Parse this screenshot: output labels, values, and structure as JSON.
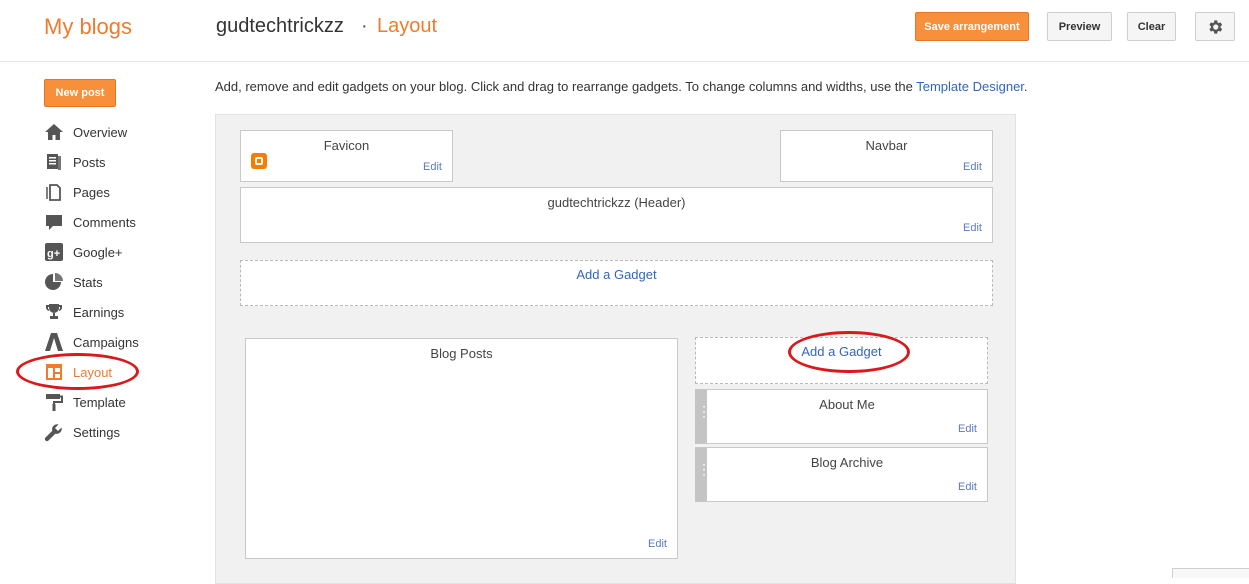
{
  "header": {
    "brand": "My blogs",
    "blog_name": "gudtechtrickzz",
    "separator": "·",
    "page": "Layout",
    "buttons": {
      "save": "Save arrangement",
      "preview": "Preview",
      "clear": "Clear"
    }
  },
  "sidebar": {
    "new_post": "New post",
    "items": [
      {
        "label": "Overview",
        "icon": "home-icon"
      },
      {
        "label": "Posts",
        "icon": "posts-icon"
      },
      {
        "label": "Pages",
        "icon": "pages-icon"
      },
      {
        "label": "Comments",
        "icon": "comment-icon"
      },
      {
        "label": "Google+",
        "icon": "google-plus-icon"
      },
      {
        "label": "Stats",
        "icon": "pie-chart-icon"
      },
      {
        "label": "Earnings",
        "icon": "trophy-icon"
      },
      {
        "label": "Campaigns",
        "icon": "adwords-icon"
      },
      {
        "label": "Layout",
        "icon": "layout-icon",
        "active": true
      },
      {
        "label": "Template",
        "icon": "paint-roller-icon"
      },
      {
        "label": "Settings",
        "icon": "wrench-icon"
      }
    ]
  },
  "main": {
    "intro_text": "Add, remove and edit gadgets on your blog. Click and drag to rearrange gadgets. To change columns and widths, use the ",
    "intro_link": "Template Designer",
    "intro_end": ".",
    "edit_label": "Edit",
    "add_gadget_label": "Add a Gadget",
    "gadgets": {
      "favicon": "Favicon",
      "navbar": "Navbar",
      "header": "gudtechtrickzz (Header)",
      "blog_posts": "Blog Posts",
      "about_me": "About Me",
      "blog_archive": "Blog Archive"
    }
  },
  "colors": {
    "accent": "#f07b2c",
    "button_orange": "#f88f3b",
    "link": "#3366bb",
    "annotation_red": "#d9191c"
  }
}
